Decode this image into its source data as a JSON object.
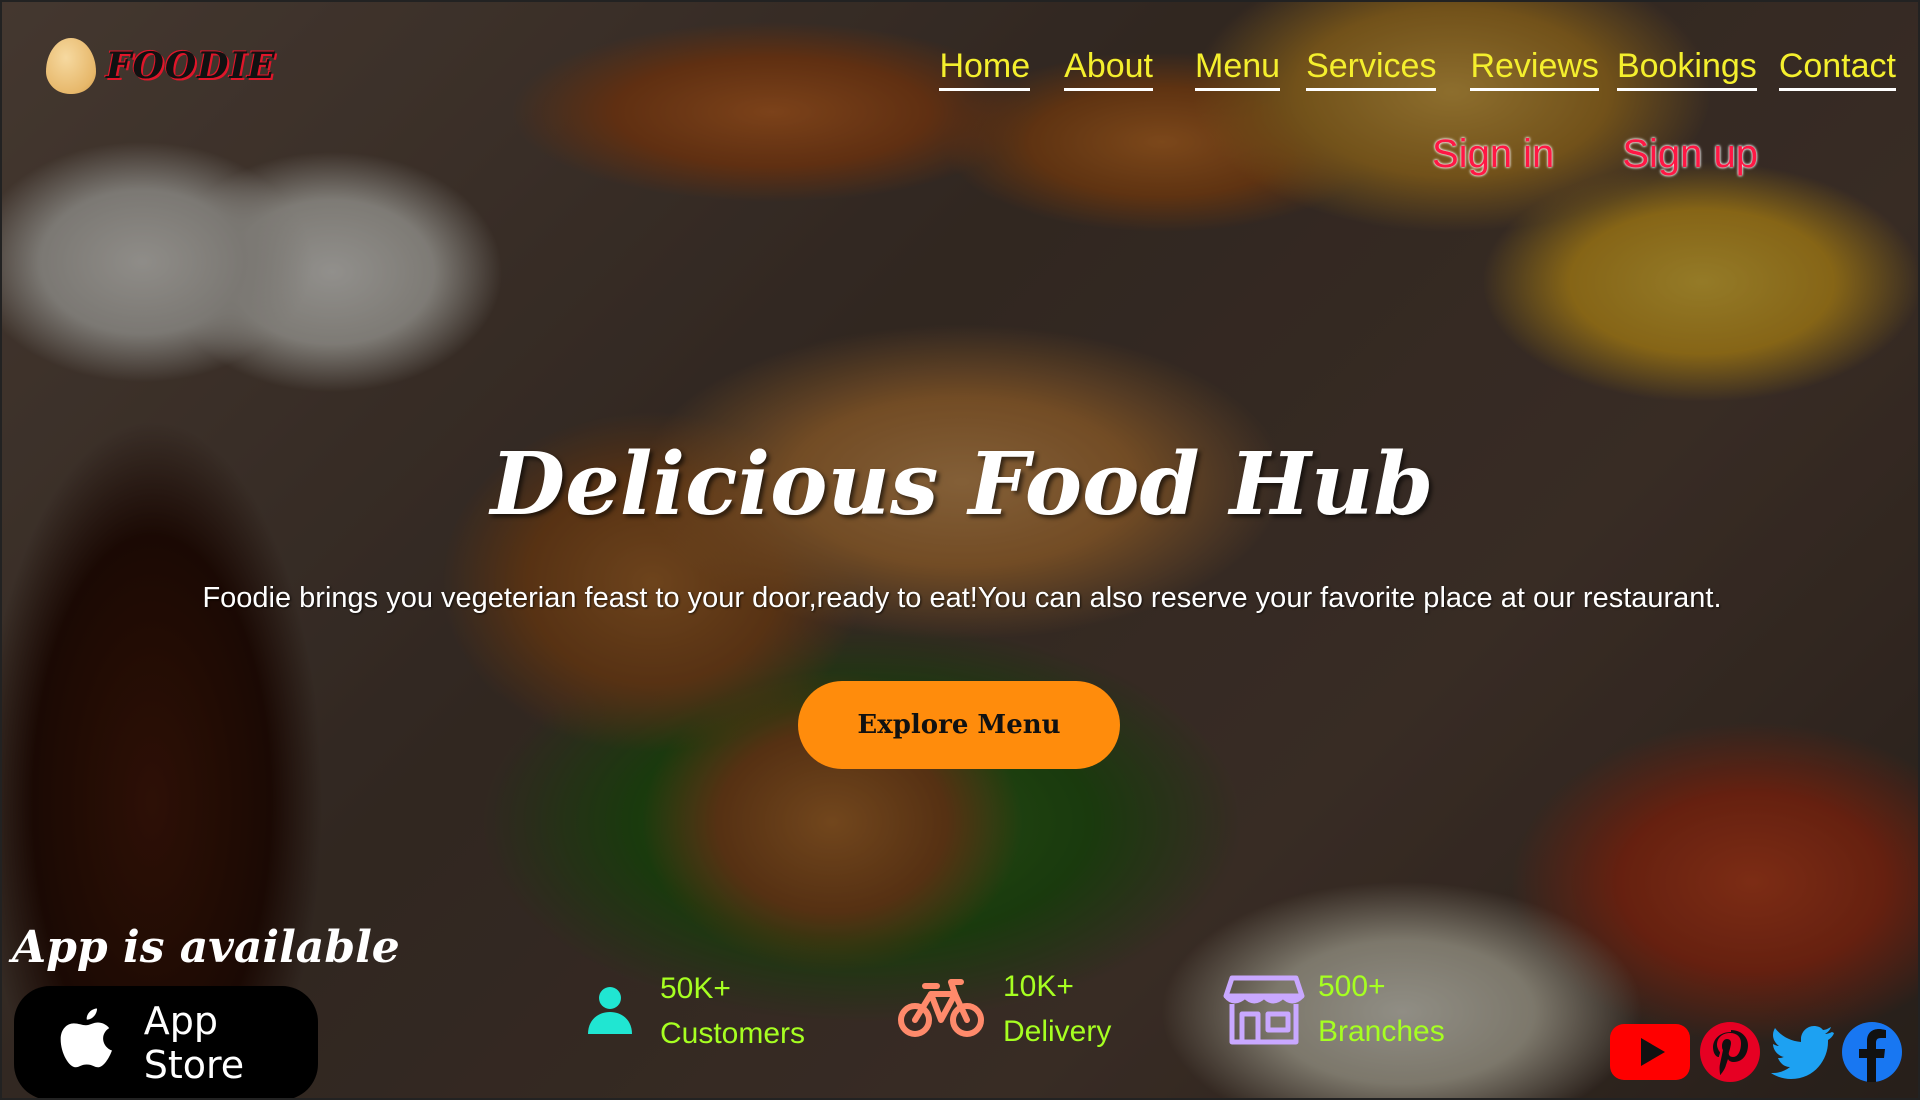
{
  "brand": {
    "name": "FOODIE"
  },
  "nav": {
    "items": [
      "Home",
      "About",
      "Menu",
      "Services",
      "Reviews",
      "Bookings",
      "Contact"
    ]
  },
  "auth": {
    "sign_in": "Sign in",
    "sign_up": "Sign up"
  },
  "hero": {
    "title": "Delicious Food Hub",
    "subtitle": "Foodie brings you vegeterian feast to your door,ready to eat!You can also reserve your favorite place at  our restaurant.",
    "cta": "Explore Menu"
  },
  "app": {
    "heading": "App is available",
    "store_label": "App Store"
  },
  "stats": [
    {
      "value": "50K+",
      "label": "Customers",
      "icon": "user-icon",
      "color": "#20e6d2"
    },
    {
      "value": "10K+",
      "label": "Delivery",
      "icon": "bicycle-icon",
      "color": "#ff8a6b"
    },
    {
      "value": "500+",
      "label": "Branches",
      "icon": "store-icon",
      "color": "#c9a8ff"
    }
  ],
  "social": [
    "youtube-icon",
    "pinterest-icon",
    "twitter-icon",
    "facebook-icon"
  ],
  "colors": {
    "nav_text": "#f4ef2d",
    "auth_text": "#ff1744",
    "cta_bg": "#ff8c0c",
    "stat_text": "#a6ff21"
  }
}
